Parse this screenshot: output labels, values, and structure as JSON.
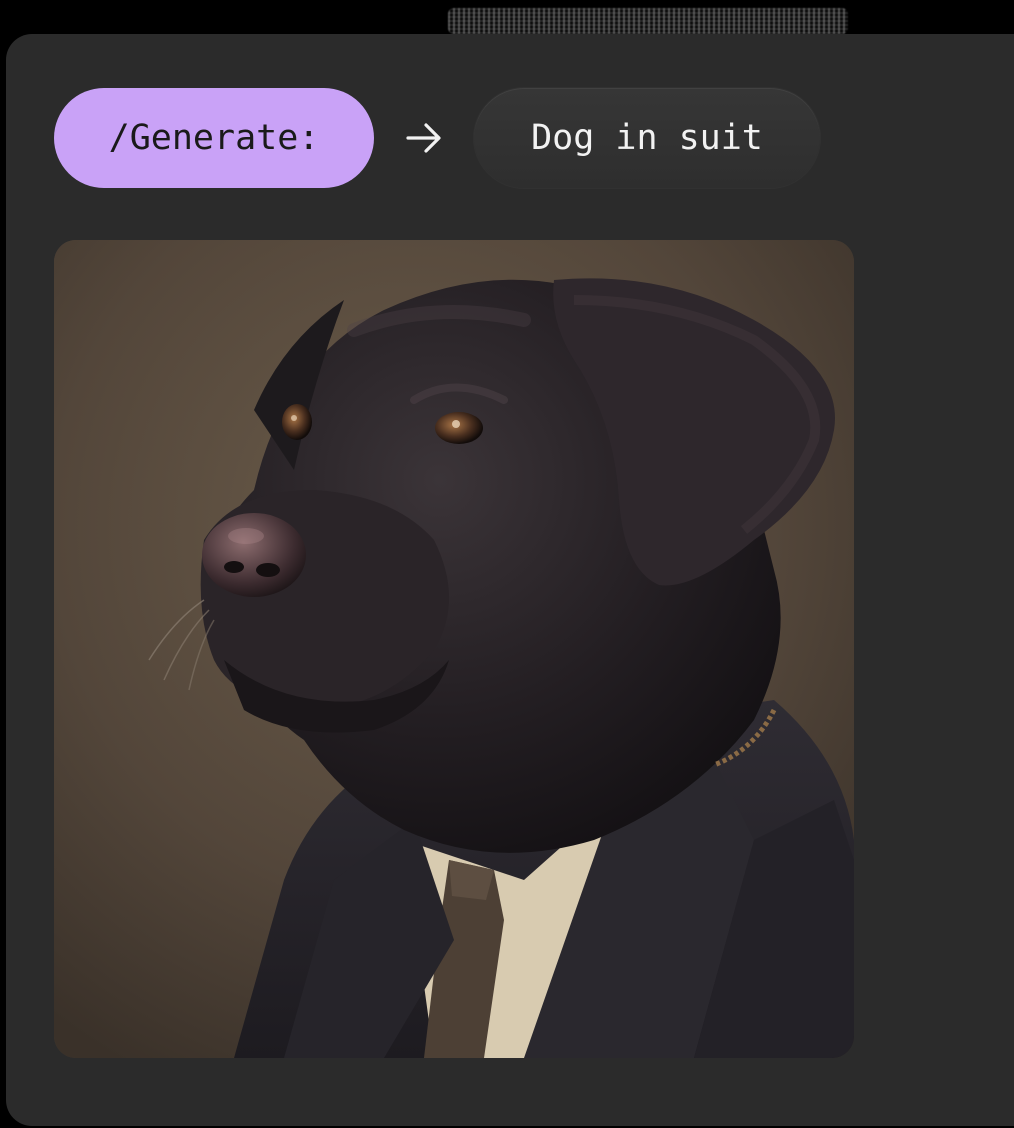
{
  "prompt": {
    "command_label": "/Generate:",
    "arrow_icon": "arrow-right-icon",
    "prompt_text": "Dog in suit"
  },
  "result": {
    "image_subject": "generated-image"
  },
  "colors": {
    "card_background": "#2b2b2b",
    "command_chip": "#c9a2f7",
    "text_chip": "#343434"
  }
}
